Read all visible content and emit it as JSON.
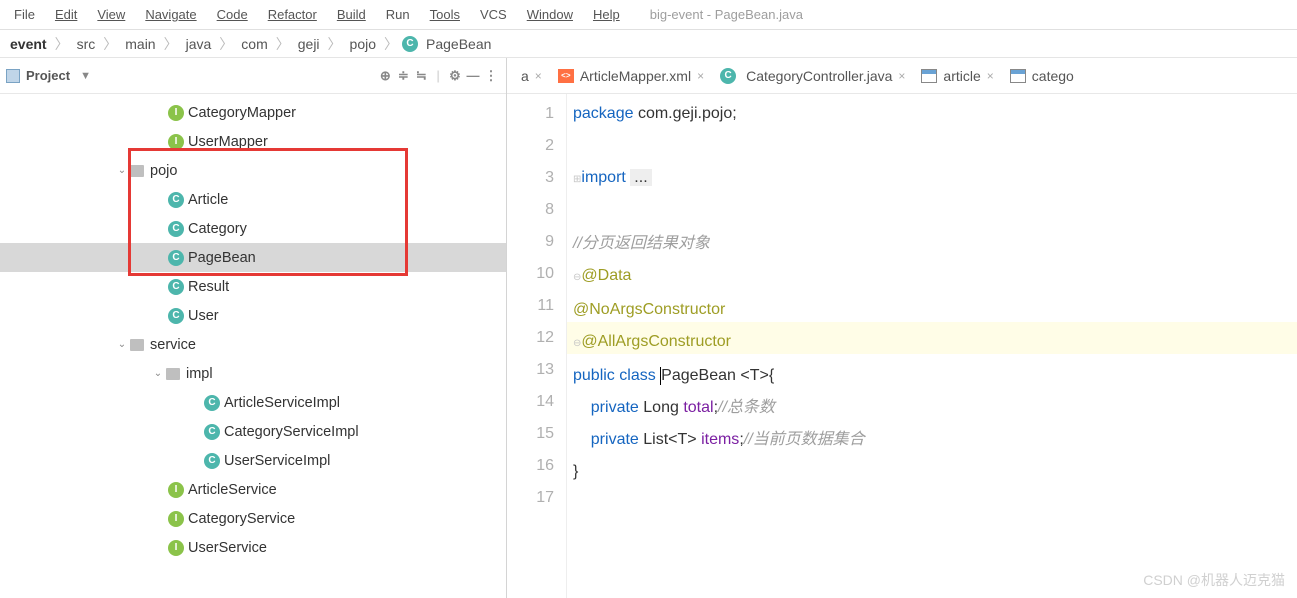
{
  "menu": {
    "items": [
      "File",
      "Edit",
      "View",
      "Navigate",
      "Code",
      "Refactor",
      "Build",
      "Run",
      "Tools",
      "VCS",
      "Window",
      "Help"
    ],
    "title": "big-event - PageBean.java"
  },
  "breadcrumb": {
    "parts": [
      "event",
      "src",
      "main",
      "java",
      "com",
      "geji",
      "pojo"
    ],
    "clazz": "PageBean"
  },
  "sidebar": {
    "title": "Project",
    "items": [
      {
        "depth": 9,
        "type": "iface",
        "label": "CategoryMapper"
      },
      {
        "depth": 9,
        "type": "iface",
        "label": "UserMapper"
      },
      {
        "depth": 6,
        "type": "folder",
        "label": "pojo",
        "expanded": true
      },
      {
        "depth": 9,
        "type": "class",
        "label": "Article"
      },
      {
        "depth": 9,
        "type": "class",
        "label": "Category"
      },
      {
        "depth": 9,
        "type": "class",
        "label": "PageBean",
        "selected": true
      },
      {
        "depth": 9,
        "type": "class",
        "label": "Result"
      },
      {
        "depth": 9,
        "type": "class",
        "label": "User"
      },
      {
        "depth": 6,
        "type": "folder",
        "label": "service",
        "expanded": true
      },
      {
        "depth": 8,
        "type": "folder",
        "label": "impl",
        "expanded": true
      },
      {
        "depth": 11,
        "type": "class",
        "label": "ArticleServiceImpl"
      },
      {
        "depth": 11,
        "type": "class",
        "label": "CategoryServiceImpl"
      },
      {
        "depth": 11,
        "type": "class",
        "label": "UserServiceImpl"
      },
      {
        "depth": 9,
        "type": "iface",
        "label": "ArticleService"
      },
      {
        "depth": 9,
        "type": "iface",
        "label": "CategoryService"
      },
      {
        "depth": 9,
        "type": "iface",
        "label": "UserService"
      }
    ]
  },
  "tabs": [
    {
      "icon": "a",
      "label": "a"
    },
    {
      "icon": "xml",
      "label": "ArticleMapper.xml"
    },
    {
      "icon": "class",
      "label": "CategoryController.java"
    },
    {
      "icon": "table",
      "label": "article"
    },
    {
      "icon": "table",
      "label": "catego"
    }
  ],
  "code": {
    "gutters": [
      "1",
      "2",
      "3",
      "8",
      "9",
      "10",
      "11",
      "12",
      "13",
      "14",
      "15",
      "16",
      "17"
    ],
    "lines": {
      "pkg_kw": "package",
      "pkg_v": "com.geji.pojo;",
      "imp_kw": "import",
      "imp_rest": "...",
      "c1": "//分页返回结果对象",
      "a1": "@Data",
      "a2": "@NoArgsConstructor",
      "a3": "@AllArgsConstructor",
      "cls1": "public",
      "cls2": "class",
      "cls3": "PageBean",
      "cls4": "<T>{",
      "f1a": "private",
      "f1b": "Long",
      "f1c": "total",
      "f1d": ";",
      "f1e": "//总条数",
      "f2a": "private",
      "f2b": "List<T>",
      "f2c": "items",
      "f2d": ";",
      "f2e": "//当前页数据集合",
      "close": "}"
    }
  },
  "watermark": "CSDN @机器人迈克猫"
}
